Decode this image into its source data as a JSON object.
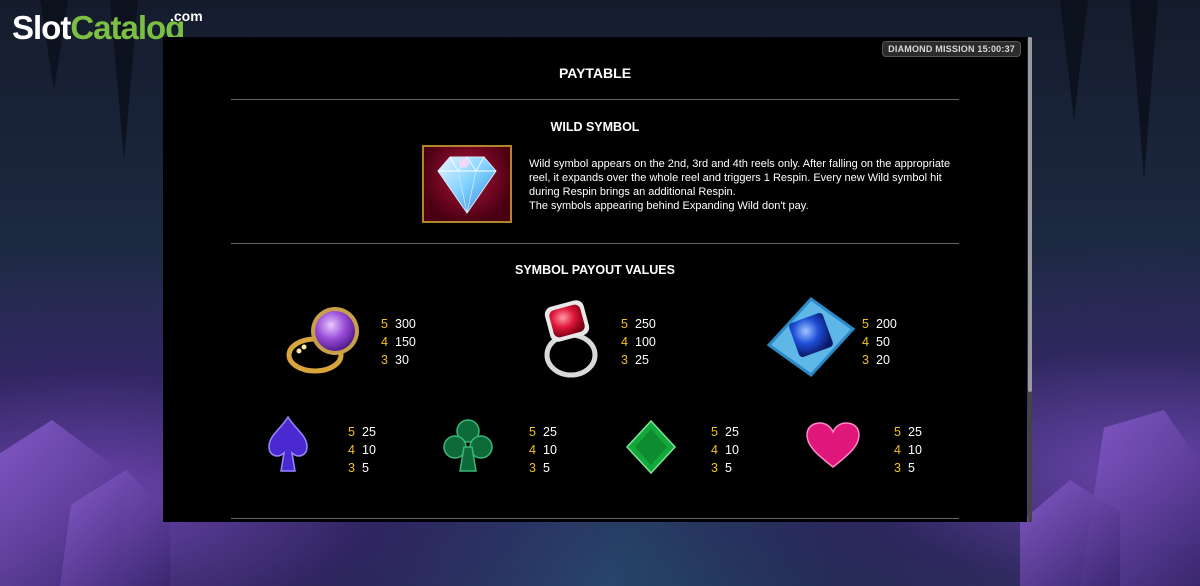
{
  "logo": {
    "slot": "Slot",
    "catalog": "Catalog",
    "com": ".com"
  },
  "mission_badge": "DIAMOND MISSION 15:00:37",
  "paytable_title": "PAYTABLE",
  "wild": {
    "title": "WILD SYMBOL",
    "description": "Wild symbol appears on the 2nd, 3rd and 4th reels only. After falling on the appropriate reel, it expands over the whole reel and triggers 1 Respin. Every new Wild symbol hit during Respin brings an additional Respin.",
    "note": "The symbols appearing behind Expanding Wild don't pay."
  },
  "payout_title": "SYMBOL PAYOUT VALUES",
  "symbols": [
    {
      "icon": "amethyst-ring-icon",
      "pays": [
        {
          "count": "5",
          "value": "300"
        },
        {
          "count": "4",
          "value": "150"
        },
        {
          "count": "3",
          "value": "30"
        }
      ]
    },
    {
      "icon": "ruby-ring-icon",
      "pays": [
        {
          "count": "5",
          "value": "250"
        },
        {
          "count": "4",
          "value": "100"
        },
        {
          "count": "3",
          "value": "25"
        }
      ]
    },
    {
      "icon": "sapphire-brooch-icon",
      "pays": [
        {
          "count": "5",
          "value": "200"
        },
        {
          "count": "4",
          "value": "50"
        },
        {
          "count": "3",
          "value": "20"
        }
      ]
    },
    {
      "icon": "spade-icon",
      "pays": [
        {
          "count": "5",
          "value": "25"
        },
        {
          "count": "4",
          "value": "10"
        },
        {
          "count": "3",
          "value": "5"
        }
      ]
    },
    {
      "icon": "club-icon",
      "pays": [
        {
          "count": "5",
          "value": "25"
        },
        {
          "count": "4",
          "value": "10"
        },
        {
          "count": "3",
          "value": "5"
        }
      ]
    },
    {
      "icon": "diamond-suit-icon",
      "pays": [
        {
          "count": "5",
          "value": "25"
        },
        {
          "count": "4",
          "value": "10"
        },
        {
          "count": "3",
          "value": "5"
        }
      ]
    },
    {
      "icon": "heart-icon",
      "pays": [
        {
          "count": "5",
          "value": "25"
        },
        {
          "count": "4",
          "value": "10"
        },
        {
          "count": "3",
          "value": "5"
        }
      ]
    }
  ],
  "colors": {
    "multiplier": "#f2c21b",
    "divider": "#666666",
    "wild_border": "#b3832d"
  }
}
